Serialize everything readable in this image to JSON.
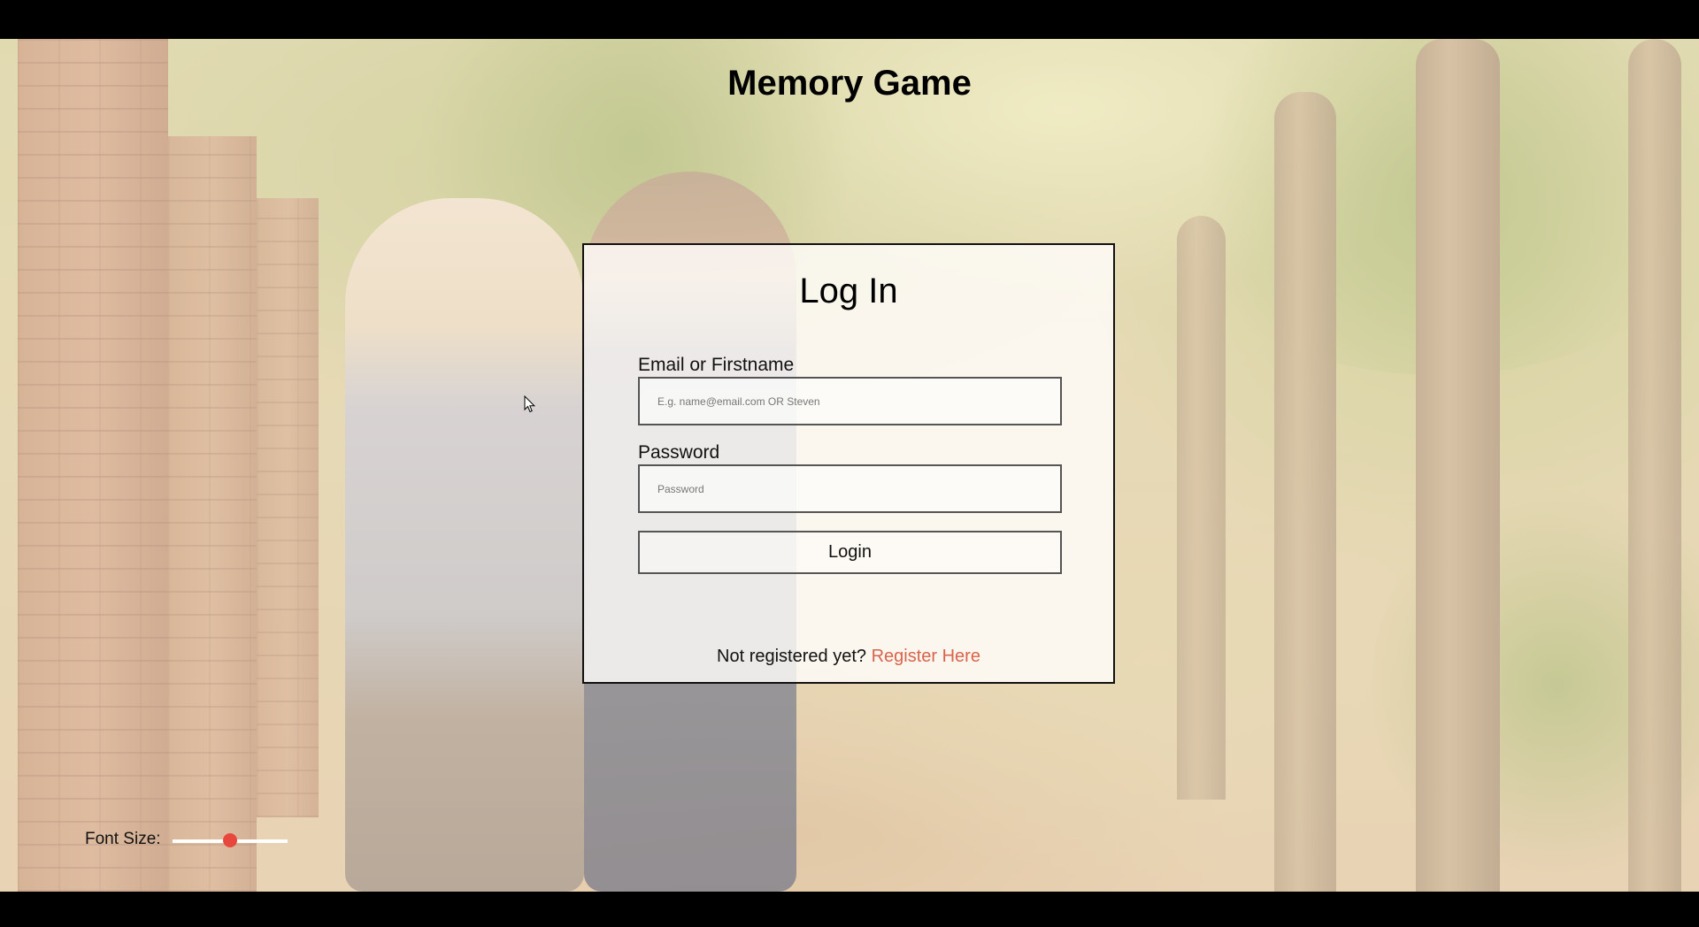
{
  "app": {
    "title": "Memory Game"
  },
  "login_card": {
    "title": "Log In",
    "email_field": {
      "label": "Email or Firstname",
      "placeholder": "E.g. name@email.com OR Steven",
      "value": ""
    },
    "password_field": {
      "label": "Password",
      "placeholder": "Password",
      "value": ""
    },
    "login_button_label": "Login",
    "register_prompt": "Not registered yet?",
    "register_link_label": "Register Here"
  },
  "font_size_control": {
    "label": "Font Size:",
    "value_fraction": 0.5
  },
  "colors": {
    "accent": "#e8473e",
    "link": "#d9644d",
    "card_border": "#111111"
  },
  "icons": {
    "cursor": "mouse-pointer-icon"
  }
}
